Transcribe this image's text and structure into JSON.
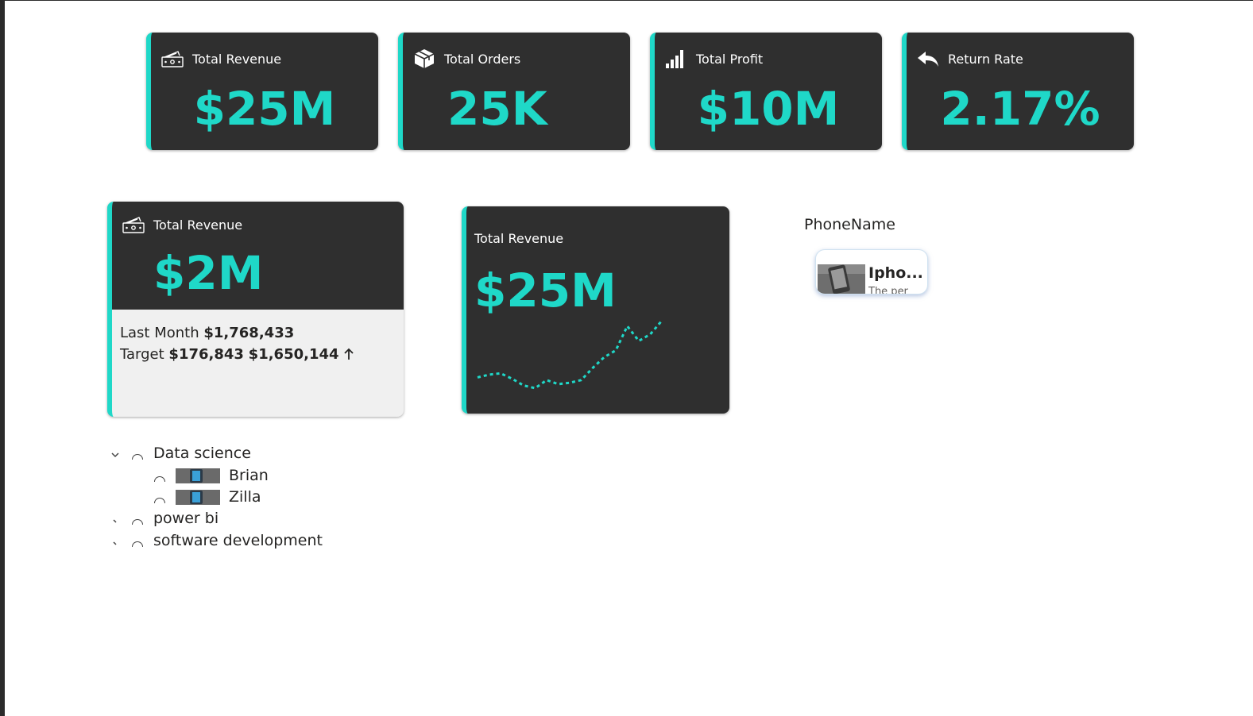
{
  "kpis": [
    {
      "title": "Total Revenue",
      "value": "$25M",
      "icon": "money-icon"
    },
    {
      "title": "Total Orders",
      "value": "25K",
      "icon": "package-icon"
    },
    {
      "title": "Total Profit",
      "value": "$10M",
      "icon": "bar-signal-icon"
    },
    {
      "title": "Return Rate",
      "value": "2.17%",
      "icon": "reply-arrow-icon"
    }
  ],
  "revenue_card": {
    "title": "Total Revenue",
    "value": "$2M",
    "last_month_label": "Last Month",
    "last_month_value": "$1,768,433",
    "target_label": "Target",
    "target_value": "$176,843",
    "target_actual": "$1,650,144",
    "trend_icon": "arrow-up-icon"
  },
  "spark_card": {
    "title": "Total Revenue",
    "value": "$25M",
    "trend": [
      18,
      20,
      21,
      17,
      12,
      10,
      16,
      13,
      14,
      16,
      25,
      33,
      38,
      56,
      45,
      50,
      60
    ]
  },
  "slicer": {
    "title": "PhoneName",
    "chip_name": "Ipho...",
    "chip_sub": "The per"
  },
  "tree": {
    "groups": [
      {
        "label": "Data science",
        "expanded": true,
        "children": [
          "Brian",
          "Zilla"
        ]
      },
      {
        "label": "power bi",
        "expanded": false
      },
      {
        "label": "software development",
        "expanded": false
      }
    ]
  },
  "colors": {
    "accent": "#1fd8c8",
    "card_bg": "#2f2f2f",
    "panel_bg": "#f0f0f0"
  }
}
